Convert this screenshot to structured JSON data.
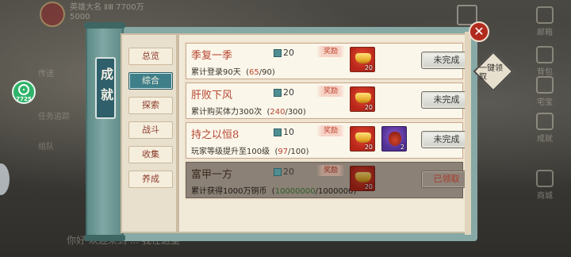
{
  "background": {
    "top_text": "英雄大名 ⅡⅢ 7700万5000",
    "chat_text": "你好 欢迎来到 ... 我在这里",
    "left_rows": [
      "传送",
      "任务追踪",
      "组队"
    ],
    "right_menu": [
      "邮箱",
      "背包",
      "宅宝",
      "成就",
      "商城"
    ],
    "timer_label": "7725"
  },
  "panel": {
    "title": "成就",
    "close_icon": "close-icon",
    "claim_all_label": "一键领取"
  },
  "tabs": [
    {
      "label": "总览",
      "active": false
    },
    {
      "label": "综合",
      "active": true
    },
    {
      "label": "探索",
      "active": false
    },
    {
      "label": "战斗",
      "active": false
    },
    {
      "label": "收集",
      "active": false
    },
    {
      "label": "养成",
      "active": false
    }
  ],
  "achievements": [
    {
      "title": "季复一季",
      "points": "20",
      "reward_tag": "奖励",
      "desc": "累计登录90天",
      "progress_current": "65",
      "progress_total": "/90",
      "items": [
        {
          "icon": "gold-ingot-icon",
          "count": "20"
        }
      ],
      "status": "未完成",
      "claimed": false
    },
    {
      "title": "肝败下风",
      "points": "20",
      "reward_tag": "奖励",
      "desc": "累计购买体力300次",
      "progress_current": "240",
      "progress_total": "/300",
      "items": [
        {
          "icon": "gold-ingot-icon",
          "count": "20"
        }
      ],
      "status": "未完成",
      "claimed": false
    },
    {
      "title": "持之以恒8",
      "points": "10",
      "reward_tag": "奖励",
      "desc": "玩家等级提升至100级",
      "progress_current": "97",
      "progress_total": "/100",
      "items": [
        {
          "icon": "gold-ingot-icon",
          "count": "20"
        },
        {
          "icon": "treasure-bag-icon",
          "count": "2"
        }
      ],
      "status": "未完成",
      "claimed": false
    },
    {
      "title": "富甲一方",
      "points": "20",
      "reward_tag": "奖励",
      "desc": "累计获得1000万铜币",
      "progress_current": "10000000",
      "progress_total": "/1000000",
      "items": [
        {
          "icon": "gold-ingot-icon",
          "count": "20"
        }
      ],
      "status": "已领取",
      "claimed": true
    }
  ]
}
